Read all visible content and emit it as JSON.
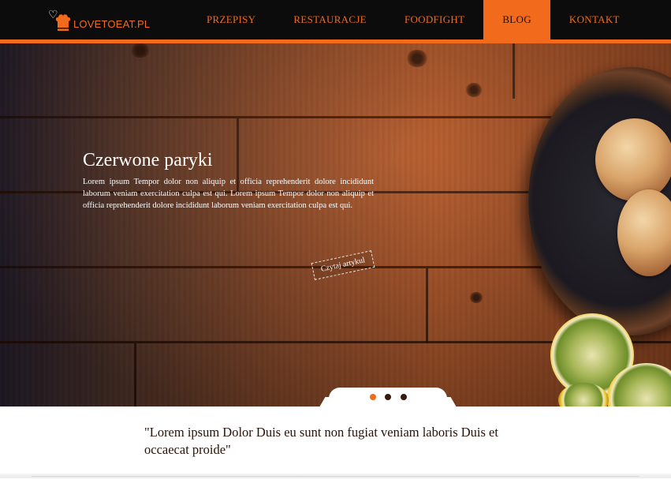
{
  "brand": {
    "name": "LOVETOEAT.PL",
    "accent": "#f26a1b"
  },
  "nav": {
    "items": [
      {
        "label": "PRZEPISY",
        "active": false
      },
      {
        "label": "RESTAURACJE",
        "active": false
      },
      {
        "label": "FOODFIGHT",
        "active": false
      },
      {
        "label": "BLOG",
        "active": true
      },
      {
        "label": "KONTAKT",
        "active": false
      }
    ]
  },
  "hero": {
    "title": "Czerwone paryki",
    "body": "Lorem ipsum Tempor dolor non aliquip et officia reprehenderit dolore incididunt laborum veniam exercitation culpa est qui. Lorem ipsum Tempor dolor non aliquip et officia reprehenderit dolore incididunt laborum veniam exercitation culpa est qui.",
    "button_label": "Czytaj artykul",
    "slides": {
      "count": 3,
      "active_index": 0
    },
    "dot_colors": {
      "active": "#f26a1b",
      "inactive": "#3a1a0c"
    }
  },
  "quote": {
    "text": "\"Lorem ipsum Dolor Duis eu sunt non fugiat veniam laboris Duis et occaecat proide\""
  }
}
